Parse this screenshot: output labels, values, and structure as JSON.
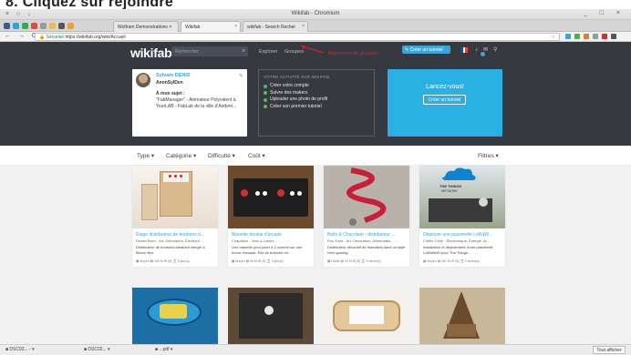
{
  "top_instruction": "8. Cliquez sur rejoindre",
  "window": {
    "title": "Wikifab - Chromium",
    "controls": "_ □ ×",
    "dots": "× ○ ↓"
  },
  "tabs": [
    {
      "label": "Wolfram Demonstrations ×",
      "active": false
    },
    {
      "label": "Wikifab",
      "active": true
    },
    {
      "label": "wikifab - Search Recher",
      "active": false
    }
  ],
  "pinned_colors": [
    "#3b5998",
    "#2aa3d8",
    "#2bb04a",
    "#e04a3a",
    "#999999",
    "#f2b84b",
    "#555555",
    "#f0a030"
  ],
  "address": {
    "nav": "← → C",
    "secure": "Sécurisé",
    "url": "https://wikifab.org/wiki/Accueil",
    "star": "☆"
  },
  "ext_colors": [
    "#3aa7d8",
    "#4caf50",
    "#e07b2b",
    "#999999",
    "#d32f2f",
    "#555555"
  ],
  "header": {
    "logo": "wikifab",
    "search_placeholder": "Rechercher",
    "search_icon": "magnifier",
    "links": [
      "Explorer",
      "Groupes"
    ],
    "annotation": "Répertoire de groupes",
    "create_button": "✎ Créer un tutoriel",
    "flag_colors": [
      "#0055a4",
      "#ffffff",
      "#ef4135"
    ],
    "icons": [
      "bell",
      "mail",
      "user"
    ]
  },
  "profile": {
    "name": "Sylvain DENIS",
    "username": "AnonSylDen",
    "subject_label": "À mon sujet :",
    "subject_text": "\"FabManager\" - Animateur Polyvalent à YourLAB - FabLab de la ville d'Andem..."
  },
  "activity": {
    "title": "VOTRE ACTIVITÉ SUR WIKIFAB",
    "items": [
      "Créer votre compte",
      "Suivre des makers",
      "Uploader une photo de profil",
      "Créer son premier tutoriel"
    ]
  },
  "launch": {
    "title": "Lancez-vous!",
    "button": "Créer un tutoriel"
  },
  "filters": {
    "type": "Type ▾",
    "category": "Catégorie ▾",
    "difficulty": "Difficulté ▾",
    "cost": "Coût ▾",
    "right": "Filtres ▾"
  },
  "cards": [
    {
      "title": "Étage distributeur de bonbons d...",
      "author": "DreamTeam",
      "categories": "Art, Décoration, Électroni...",
      "desc": "Distributeur de bonbons aléatoire intégré à Bernic Box.",
      "stats": "▦ Moyen  ▤ 150 EUR (€)  ⌛ 3 jour(s)"
    },
    {
      "title": "Manette double d'arcade",
      "author": "Chapollon",
      "categories": "Jeux & Loisirs",
      "desc": "Une manette pour jouer à 2 comme sur une borne d'arcade. Elle se branche en...",
      "stats": "▦ Moyen  ▤ 60 EUR (€)  ⌛ 3 jour(s)"
    },
    {
      "title": "Bolts & Chocolate - distributeur ...",
      "author": "Eric Soria",
      "categories": "Art, Décoration, Alimentatio...",
      "desc": "Distributeur décoratif de friandises dans un style rétro gaming.",
      "stats": "▦ Facile  ▤ 30 EUR (€)  ⌛ 4 heure(s)"
    },
    {
      "title": "Déployer une passerelle LoRaW...",
      "author": "Clothe Guity",
      "categories": "Électronique, Énergie, Al...",
      "desc": "Installation et déploiement d'une passerelle LoRaWAN pour The Things...",
      "stats": "▦ Moyen  ▤ 187 EUR (€)  ⌛ 2 heure(s)"
    }
  ],
  "card_mid_sep": "·",
  "second_row_captions": [
    "THE THINGS",
    "NETWORK"
  ],
  "downloads": [
    {
      "label": "■ DSC02... - ▾"
    },
    {
      "label": "■ DSC02... ▾"
    },
    {
      "label": "■ ...pdf ▾"
    }
  ],
  "downloads_button": "Tout afficher"
}
